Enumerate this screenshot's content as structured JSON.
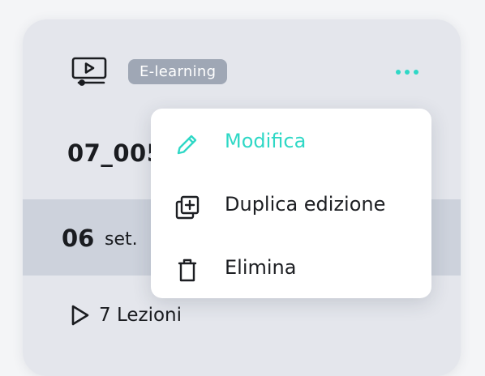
{
  "card": {
    "type_icon": "video-lesson-icon",
    "badge": "E-learning",
    "more_icon": "more-horizontal-icon",
    "code": "07_005",
    "date_day": "06",
    "date_month": "set.",
    "lessons_icon": "play-icon",
    "lessons_label": "7 Lezioni"
  },
  "menu": {
    "items": [
      {
        "label": "Modifica",
        "icon": "pencil-icon",
        "active": true
      },
      {
        "label": "Duplica edizione",
        "icon": "duplicate-icon",
        "active": false
      },
      {
        "label": "Elimina",
        "icon": "trash-icon",
        "active": false
      }
    ]
  },
  "colors": {
    "accent": "#2fd8c6",
    "card_bg": "#e4e6ec",
    "date_row_bg": "#cdd2dc",
    "badge_bg": "#9fa7b5",
    "text": "#1a1c20"
  }
}
